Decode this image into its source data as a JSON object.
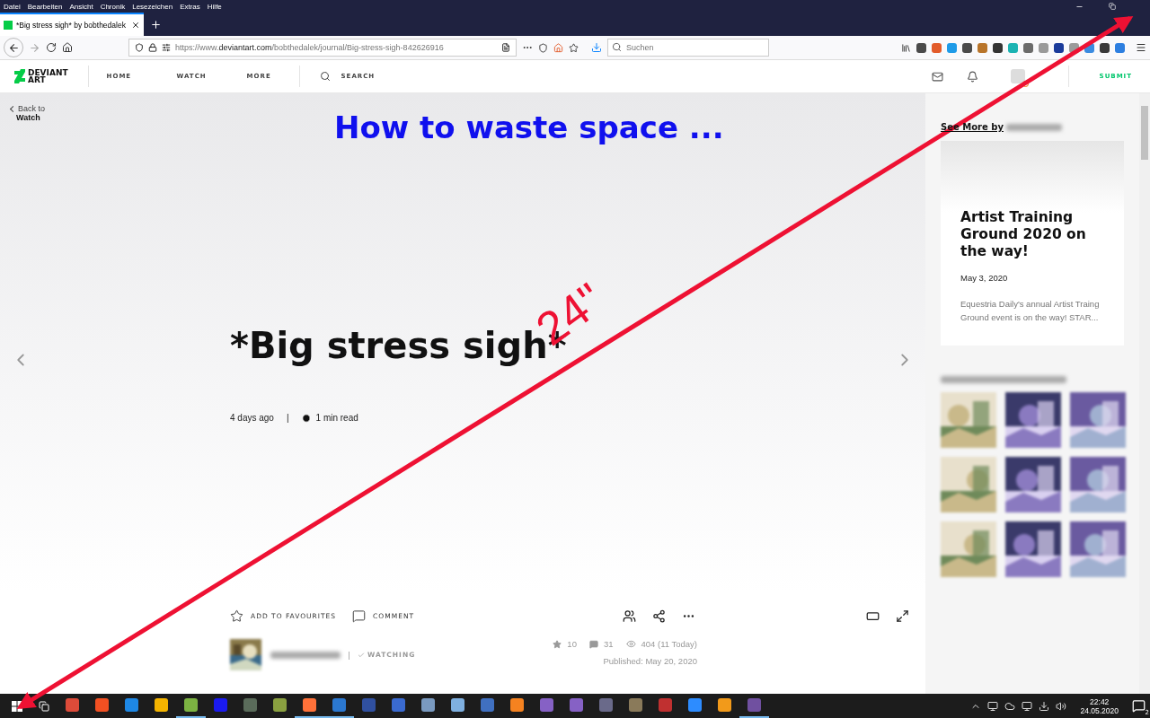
{
  "menu_bar": [
    "Datei",
    "Bearbeiten",
    "Ansicht",
    "Chronik",
    "Lesezeichen",
    "Extras",
    "Hilfe"
  ],
  "tab": {
    "title": "*Big stress sigh* by bobthedalek"
  },
  "address_bar": {
    "url_prefix": "https://www.",
    "url_domain": "deviantart.com",
    "url_path": "/bobthedalek/journal/Big-stress-sigh-842626916"
  },
  "search": {
    "placeholder": "Suchen"
  },
  "extensions": [
    {
      "color": "#4a4a4a"
    },
    {
      "color": "#e25b2a"
    },
    {
      "color": "#1e9be8"
    },
    {
      "color": "#4a4a4a"
    },
    {
      "color": "#b8742a"
    },
    {
      "color": "#333333"
    },
    {
      "color": "#1bb3b3"
    },
    {
      "color": "#6b6b6b"
    },
    {
      "color": "#9a9a9a"
    },
    {
      "color": "#1a3a9a"
    },
    {
      "color": "#9a9a9a"
    },
    {
      "color": "#3b8be0"
    },
    {
      "color": "#3a3a3a"
    },
    {
      "color": "#2d7fe0"
    }
  ],
  "site_nav": {
    "logo_top": "DEVIANT",
    "logo_bottom": "ART",
    "links": [
      "HOME",
      "WATCH",
      "MORE"
    ],
    "search": "SEARCH",
    "submit": "SUBMIT"
  },
  "back_link": {
    "label": "Back to",
    "target": "Watch"
  },
  "annotation": {
    "caption": "How to waste space ...",
    "size_label": "24\""
  },
  "article": {
    "title": "*Big stress sigh*",
    "age": "4 days ago",
    "separator": "|",
    "read_time": "1 min read"
  },
  "actions": [
    {
      "kind": "favourite",
      "label": "ADD TO FAVOURITES"
    },
    {
      "kind": "comment",
      "label": "COMMENT"
    }
  ],
  "author": {
    "separator": "|",
    "status": "WATCHING"
  },
  "stats": {
    "favourites": "10",
    "comments": "31",
    "views": "404 (11 Today)",
    "published": "Published: May 20, 2020"
  },
  "sidebar": {
    "heading": "See More by",
    "card": {
      "title": "Artist Training Ground 2020 on the way!",
      "date": "May 3, 2020",
      "excerpt": "Equestria Daily's annual Artist Traing Ground event is on the way! STAR..."
    }
  },
  "taskbar": {
    "apps": [
      {
        "color": "#dd4b39",
        "active": false
      },
      {
        "color": "#f25022",
        "active": false
      },
      {
        "color": "#1e88e5",
        "active": false
      },
      {
        "color": "#f4b400",
        "active": false
      },
      {
        "color": "#7cb342",
        "active": true
      },
      {
        "color": "#1a1aee",
        "active": false
      },
      {
        "color": "#5a6b5a",
        "active": false
      },
      {
        "color": "#8aa040",
        "active": false
      },
      {
        "color": "#ff7139",
        "active": true
      },
      {
        "color": "#2b78d0",
        "active": true
      },
      {
        "color": "#3050a0",
        "active": false
      },
      {
        "color": "#3a6ad0",
        "active": false
      },
      {
        "color": "#7a9ac0",
        "active": false
      },
      {
        "color": "#7fb0e0",
        "active": false
      },
      {
        "color": "#4070c0",
        "active": false
      },
      {
        "color": "#f58220",
        "active": false
      },
      {
        "color": "#8661c5",
        "active": false
      },
      {
        "color": "#8661c5",
        "active": false
      },
      {
        "color": "#6a6a8a",
        "active": false
      },
      {
        "color": "#8a7a5a",
        "active": false
      },
      {
        "color": "#c03030",
        "active": false
      },
      {
        "color": "#2d8cff",
        "active": false
      },
      {
        "color": "#f29a1a",
        "active": false
      },
      {
        "color": "#7050a0",
        "active": true
      }
    ],
    "time": "22:42",
    "date": "24.05.2020",
    "notifications": "2"
  }
}
